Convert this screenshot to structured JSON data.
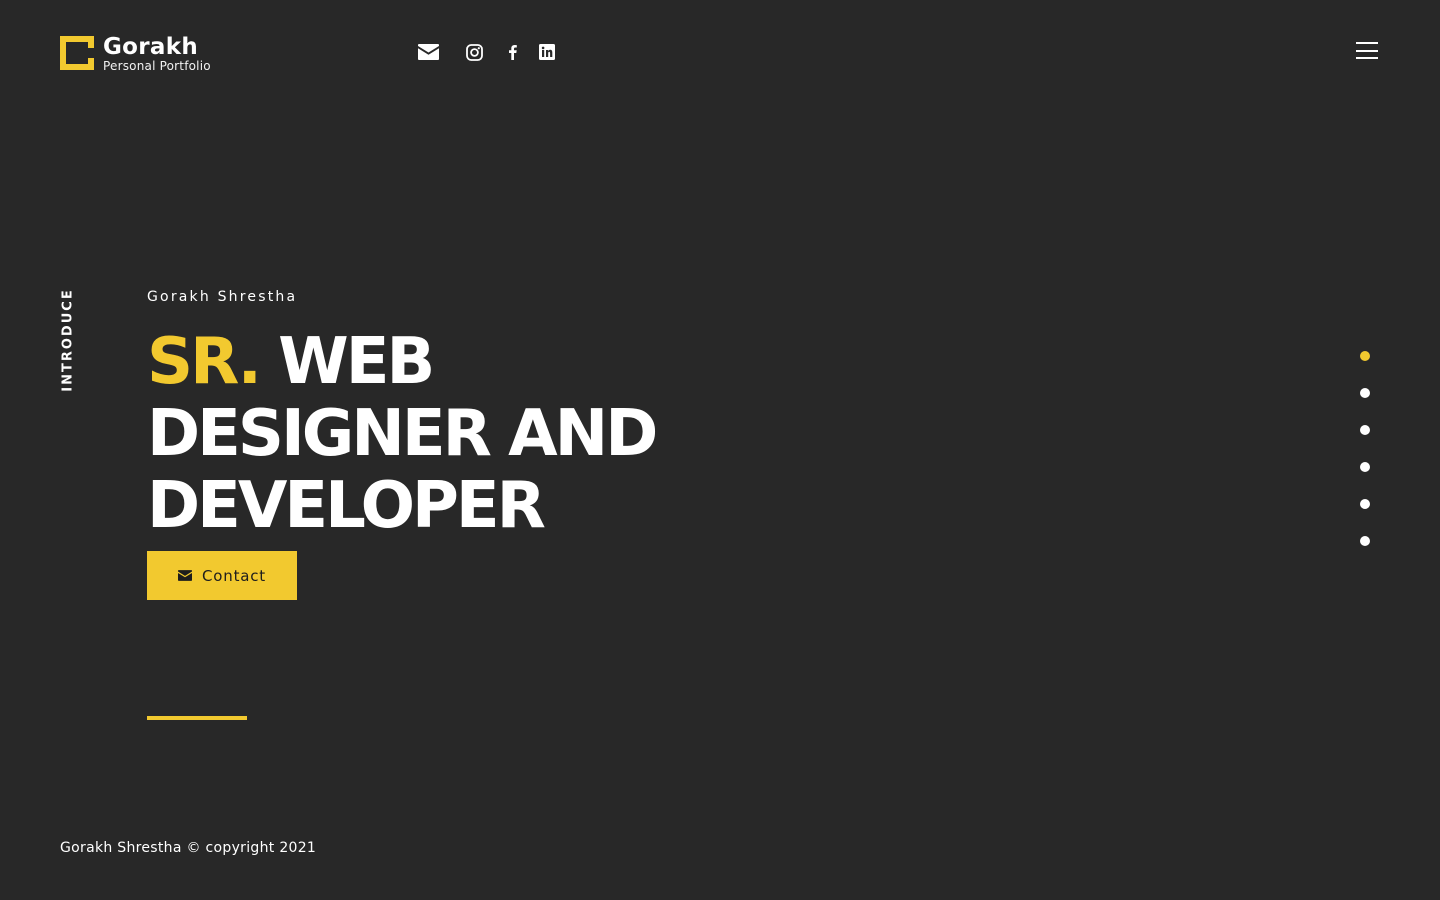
{
  "colors": {
    "background": "#282828",
    "accent": "#f2c92f",
    "text": "#ffffff"
  },
  "brand": {
    "name": "Gorakh",
    "subtitle": "Personal Portfolio",
    "icon": "logo-mark-icon"
  },
  "socials": [
    {
      "icon": "envelope-icon"
    },
    {
      "icon": "instagram-icon"
    },
    {
      "icon": "facebook-icon"
    },
    {
      "icon": "linkedin-icon"
    }
  ],
  "menu": {
    "icon": "hamburger-menu-icon"
  },
  "side_label": "INTRODUCE",
  "hero": {
    "name": "Gorakh Shrestha",
    "title_accent": "SR.",
    "title_line1_rest": "WEB",
    "title_line2": "DESIGNER AND",
    "title_line3": "DEVELOPER",
    "contact_label": "Contact",
    "contact_icon": "envelope-icon"
  },
  "section_dots": {
    "count": 6,
    "active_index": 0
  },
  "footer": {
    "copyright": "Gorakh Shrestha © copyright 2021"
  }
}
